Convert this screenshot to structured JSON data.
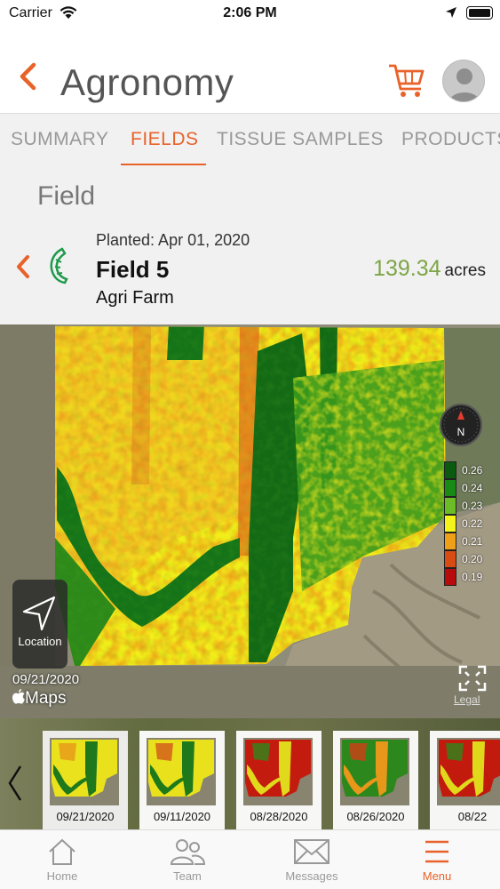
{
  "status_bar": {
    "carrier": "Carrier",
    "time": "2:06 PM"
  },
  "header": {
    "title": "Agronomy"
  },
  "tabs": [
    {
      "label": "SUMMARY",
      "active": false
    },
    {
      "label": "FIELDS",
      "active": true
    },
    {
      "label": "TISSUE SAMPLES",
      "active": false
    },
    {
      "label": "PRODUCTS",
      "active": false
    }
  ],
  "field": {
    "heading": "Field",
    "planted": "Planted:  Apr 01, 2020",
    "name": "Field 5",
    "farm": "Agri Farm",
    "acres_value": "139.34",
    "acres_unit": "acres"
  },
  "map": {
    "legend": [
      {
        "label": "0.26",
        "color": "#0a5a10"
      },
      {
        "label": "0.24",
        "color": "#188a16"
      },
      {
        "label": "0.23",
        "color": "#6cbc28"
      },
      {
        "label": "0.22",
        "color": "#f4f41a"
      },
      {
        "label": "0.21",
        "color": "#f0a018"
      },
      {
        "label": "0.20",
        "color": "#d84c14"
      },
      {
        "label": "0.19",
        "color": "#b80c0c"
      }
    ],
    "location_label": "Location",
    "date": "09/21/2020",
    "provider": "Maps",
    "legal": "Legal",
    "compass_label": "N"
  },
  "thumbnails": [
    {
      "date": "09/21/2020",
      "selected": true
    },
    {
      "date": "09/11/2020",
      "selected": false
    },
    {
      "date": "08/28/2020",
      "selected": false
    },
    {
      "date": "08/26/2020",
      "selected": false
    },
    {
      "date": "08/22",
      "selected": false
    }
  ],
  "tabbar": [
    {
      "label": "Home",
      "icon": "home-icon",
      "active": false
    },
    {
      "label": "Team",
      "icon": "team-icon",
      "active": false
    },
    {
      "label": "Messages",
      "icon": "envelope-icon",
      "active": false
    },
    {
      "label": "Menu",
      "icon": "hamburger-menu-icon",
      "active": true
    }
  ]
}
